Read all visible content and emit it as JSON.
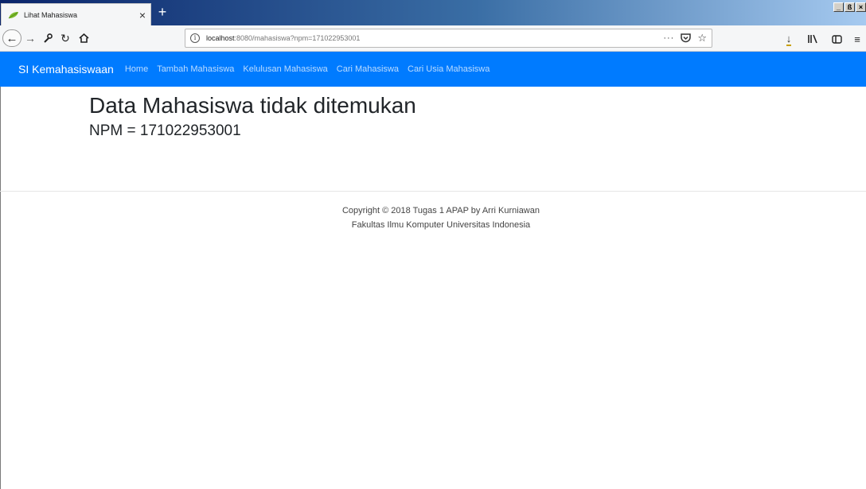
{
  "browser": {
    "tab_title": "Lihat Mahasiswa",
    "tab_close": "×",
    "new_tab": "+",
    "url_host": "localhost",
    "url_path": ":8080/mahasiswa?npm=171022953001",
    "url_more": "···",
    "window_controls": [
      "_",
      "ß",
      "×"
    ]
  },
  "app": {
    "brand": "SI Kemahasiswaan",
    "nav_links": [
      "Home",
      "Tambah Mahasiswa",
      "Kelulusan Mahasiswa",
      "Cari Mahasiswa",
      "Cari Usia Mahasiswa"
    ],
    "nav_color": "#007bff"
  },
  "main": {
    "heading": "Data Mahasiswa tidak ditemukan",
    "npm_line": "NPM = 171022953001"
  },
  "footer": {
    "line1": "Copyright © 2018 Tugas 1 APAP by Arri Kurniawan",
    "line2": "Fakultas Ilmu Komputer Universitas Indonesia"
  }
}
